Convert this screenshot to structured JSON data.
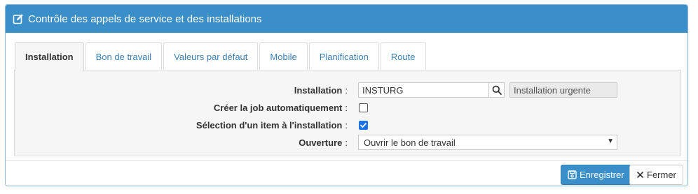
{
  "header": {
    "icon": "edit-icon",
    "title": "Contrôle des appels de service et des installations"
  },
  "tabs": [
    {
      "label": "Installation",
      "active": true
    },
    {
      "label": "Bon de travail",
      "active": false
    },
    {
      "label": "Valeurs par défaut",
      "active": false
    },
    {
      "label": "Mobile",
      "active": false
    },
    {
      "label": "Planification",
      "active": false
    },
    {
      "label": "Route",
      "active": false
    }
  ],
  "form": {
    "installation": {
      "label": "Installation",
      "value": "INSTURG",
      "description": "Installation urgente",
      "search_icon": "search-icon"
    },
    "auto_job": {
      "label": "Créer la job automatiquement",
      "checked": false
    },
    "select_item": {
      "label": "Sélection d'un item à l'installation",
      "checked": true
    },
    "opening": {
      "label": "Ouverture",
      "selected": "Ouvrir le bon de travail"
    },
    "colon": ":"
  },
  "footer": {
    "save_label": "Enregistrer",
    "save_icon": "save-icon",
    "close_label": "Fermer",
    "close_icon": "close-icon"
  },
  "colors": {
    "header_bg": "#3a8fc9",
    "primary": "#3a8fc9",
    "tab_link": "#3a7fb5",
    "checkbox_checked": "#1a73e8"
  }
}
